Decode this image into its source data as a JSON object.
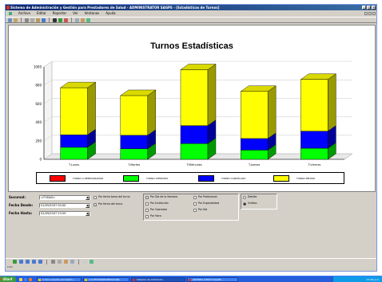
{
  "window": {
    "title": "Sistema de Administración y Gestión para Prestadores de Salud - ADMINISTRATOR  SAGPS - [Estadísticas de Turnos]"
  },
  "menu": {
    "items": [
      "Archivo",
      "Editar",
      "Reportar",
      "Ver",
      "Ventanas",
      "Ayuda"
    ]
  },
  "chart_data": {
    "type": "bar",
    "title": "Turnos Estadísticas",
    "categories": [
      "T.Lunes",
      "T.Martes",
      "T.Miércoles",
      "T.Jueves",
      "T.Viernes"
    ],
    "series": [
      {
        "name": "TURNO A REPROGRAMAR",
        "color": "#ff0000",
        "values": [
          0,
          0,
          0,
          0,
          0
        ]
      },
      {
        "name": "TURNO ATENDIDO",
        "color": "#00ff00",
        "values": [
          130,
          115,
          170,
          100,
          120
        ]
      },
      {
        "name": "TURNO CANCELADO",
        "color": "#0000ff",
        "values": [
          135,
          145,
          195,
          125,
          185
        ]
      },
      {
        "name": "TURNO PEDIDO",
        "color": "#ffff00",
        "values": [
          510,
          430,
          605,
          510,
          560
        ]
      }
    ],
    "stacked": true,
    "three_d": true,
    "ylim": [
      0,
      1000
    ],
    "yticks": [
      0,
      200,
      400,
      600,
      800,
      1000
    ],
    "grid": true,
    "legend_position": "bottom"
  },
  "filters": {
    "sucursal_label": "Sucursal:",
    "sucursal_value": "<TODAS>",
    "fecha_desde_label": "Fecha Desde:",
    "fecha_desde_value": "01/05/2007 00:00",
    "fecha_hasta_label": "Fecha Hasta:",
    "fecha_hasta_value": "02/09/2007 23:59",
    "fecha_toma_label": "Por fecha toma del turno",
    "fecha_toma_checked": false,
    "fecha_turno_label": "Por fecha del turno",
    "fecha_turno_checked": true
  },
  "grouping": {
    "dia_semana": {
      "label": "Por Día de la Semana",
      "checked": true
    },
    "institucion": {
      "label": "Por Institución",
      "checked": false
    },
    "operador": {
      "label": "Por Operador",
      "checked": false
    },
    "hora": {
      "label": "Por Hora",
      "checked": false
    },
    "profesional": {
      "label": "Por Profesional",
      "checked": false
    },
    "especialidad": {
      "label": "Por Especialidad",
      "checked": false
    },
    "dia": {
      "label": "Por Día",
      "checked": false
    }
  },
  "view_mode": {
    "detalle": {
      "label": "Detalle",
      "checked": false
    },
    "grafico": {
      "label": "Gráfico",
      "checked": true
    }
  },
  "status": {
    "text": "Listo"
  },
  "taskbar": {
    "start_label": "Start",
    "items": [
      {
        "label": "C:\\Documents and Settin...",
        "active": false
      },
      {
        "label": "C:\\UTECH\\PRESENTACION",
        "active": false
      },
      {
        "label": "Sistema de Administr...",
        "active": true
      },
      {
        "label": "SISTEMA QTECH SAGPS...",
        "active": false
      }
    ],
    "clock": "01:39 p.m."
  }
}
